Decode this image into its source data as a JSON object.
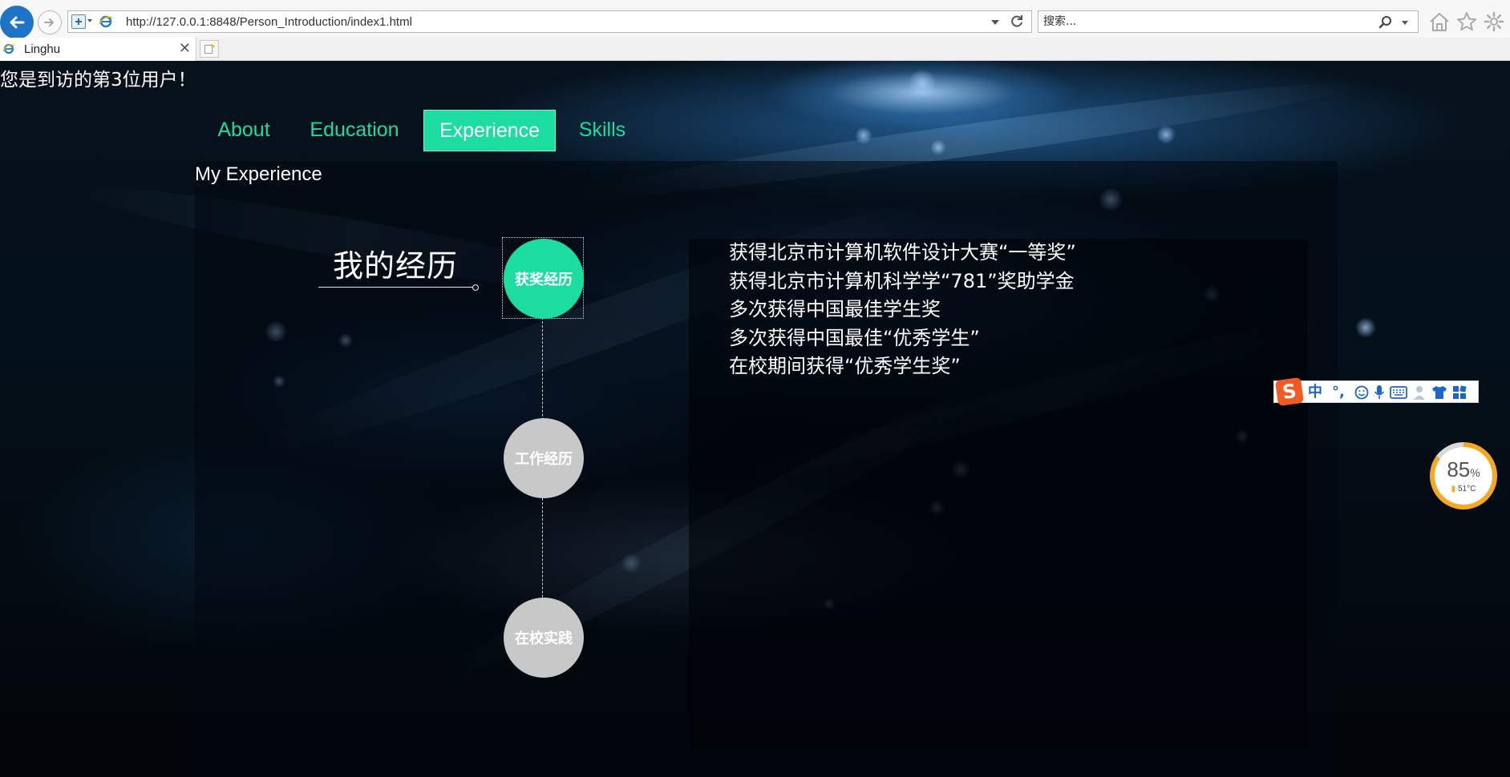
{
  "browser": {
    "url": "http://127.0.0.1:8848/Person_Introduction/index1.html",
    "search_placeholder": "搜索...",
    "tab_title": "Linghu",
    "tab_close": "✕"
  },
  "page": {
    "visitor_text": "您是到访的第3位用户！",
    "nav": [
      "About",
      "Education",
      "Experience",
      "Skills"
    ],
    "active_nav": "Experience",
    "section_title": "My Experience",
    "heading": "我的经历",
    "timeline": [
      "获奖经历",
      "工作经历",
      "在校实践"
    ],
    "active_timeline": "获奖经历",
    "awards": [
      "获得北京市计算机软件设计大赛“一等奖”",
      "获得北京市计算机科学学“781”奖助学金",
      "多次获得中国最佳学生奖",
      "多次获得中国最佳“优秀学生”",
      "在校期间获得“优秀学生奖”"
    ]
  },
  "ime": {
    "logo": "S",
    "mode": "中",
    "punct": "°,"
  },
  "cpu_gauge": {
    "value": "85",
    "unit": "%",
    "percent": 85,
    "temp": "51°C"
  },
  "colors": {
    "accent": "#1ddc9f",
    "inactive_node": "#c8c8c8",
    "gauge": "#f7a823",
    "browser_back": "#1f73c7"
  }
}
